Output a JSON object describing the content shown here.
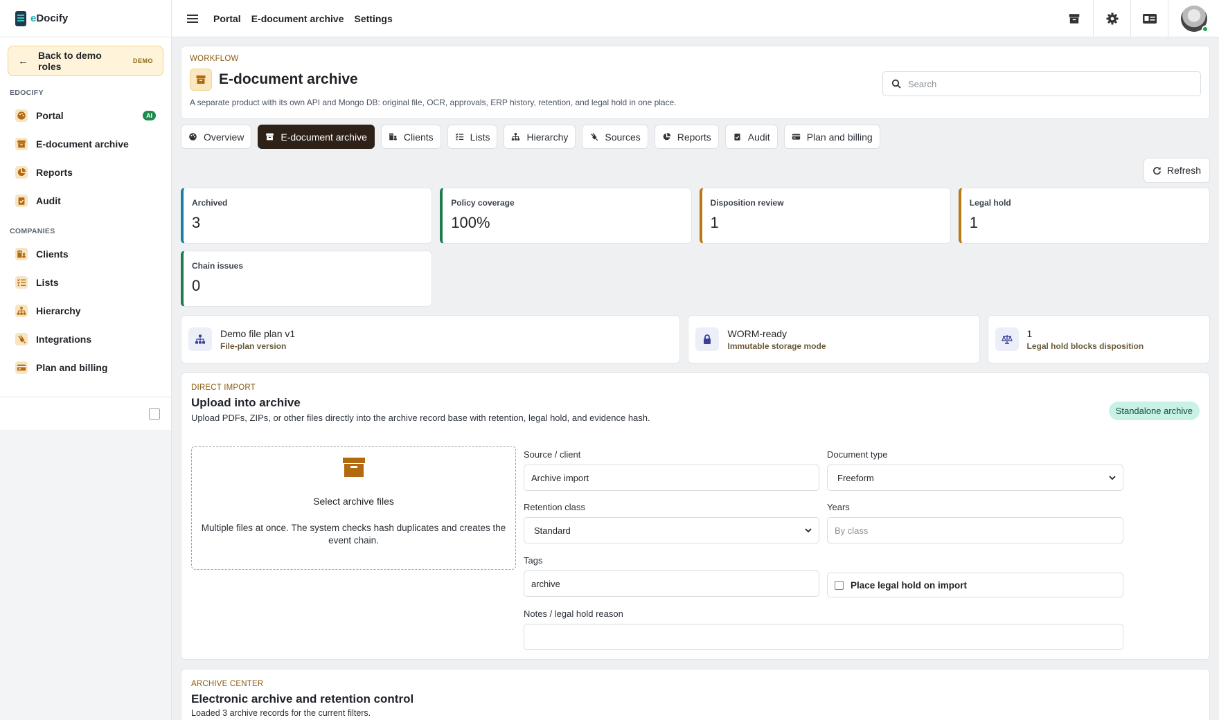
{
  "brand": {
    "prefix": "e",
    "name": "Docify"
  },
  "sidebar": {
    "back_label": "Back to demo roles",
    "back_badge": "DEMO",
    "sections": [
      {
        "title": "EDOCIFY",
        "items": [
          {
            "label": "Portal",
            "icon": "palette-icon",
            "badge": "AI"
          },
          {
            "label": "E-document archive",
            "icon": "archive-box-icon"
          },
          {
            "label": "Reports",
            "icon": "pie-chart-icon"
          },
          {
            "label": "Audit",
            "icon": "clipboard-check-icon"
          }
        ]
      },
      {
        "title": "COMPANIES",
        "items": [
          {
            "label": "Clients",
            "icon": "building-users-icon"
          },
          {
            "label": "Lists",
            "icon": "list-check-icon"
          },
          {
            "label": "Hierarchy",
            "icon": "sitemap-icon"
          },
          {
            "label": "Integrations",
            "icon": "plug-icon"
          },
          {
            "label": "Plan and billing",
            "icon": "credit-card-icon"
          }
        ]
      }
    ]
  },
  "topbar": {
    "links": [
      "Portal",
      "E-document archive",
      "Settings"
    ],
    "icons": [
      "archive-icon",
      "gear-icon",
      "id-card-icon",
      "avatar"
    ]
  },
  "header": {
    "eyebrow": "WORKFLOW",
    "title": "E-document archive",
    "subtitle": "A separate product with its own API and Mongo DB: original file, OCR, approvals, ERP history, retention, and legal hold in one place.",
    "search_placeholder": "Search"
  },
  "tabs": [
    {
      "label": "Overview",
      "icon": "palette-icon"
    },
    {
      "label": "E-document archive",
      "icon": "archive-box-icon",
      "active": true
    },
    {
      "label": "Clients",
      "icon": "building-users-icon"
    },
    {
      "label": "Lists",
      "icon": "list-check-icon"
    },
    {
      "label": "Hierarchy",
      "icon": "sitemap-icon"
    },
    {
      "label": "Sources",
      "icon": "plug-icon"
    },
    {
      "label": "Reports",
      "icon": "pie-chart-icon"
    },
    {
      "label": "Audit",
      "icon": "clipboard-check-icon"
    },
    {
      "label": "Plan and billing",
      "icon": "credit-card-icon"
    }
  ],
  "refresh_label": "Refresh",
  "stats": [
    {
      "label": "Archived",
      "value": "3",
      "accent": "#1a7fa6"
    },
    {
      "label": "Policy coverage",
      "value": "100%",
      "accent": "#1f7a4d"
    },
    {
      "label": "Disposition review",
      "value": "1",
      "accent": "#b97814"
    },
    {
      "label": "Legal hold",
      "value": "1",
      "accent": "#b97814"
    },
    {
      "label": "Chain issues",
      "value": "0",
      "accent": "#1f7a4d"
    }
  ],
  "info_cards": [
    {
      "title": "Demo file plan v1",
      "sub": "File-plan version",
      "icon": "sitemap-icon"
    },
    {
      "title": "WORM-ready",
      "sub": "Immutable storage mode",
      "icon": "lock-icon"
    },
    {
      "title": "1",
      "sub": "Legal hold blocks disposition",
      "icon": "scale-icon"
    }
  ],
  "upload": {
    "eyebrow": "DIRECT IMPORT",
    "title": "Upload into archive",
    "desc": "Upload PDFs, ZIPs, or other files directly into the archive record base with retention, legal hold, and evidence hash.",
    "pill": "Standalone archive",
    "dropzone_title": "Select archive files",
    "dropzone_desc": "Multiple files at once. The system checks hash duplicates and creates the event chain.",
    "source_label": "Source / client",
    "source_value": "Archive import",
    "doctype_label": "Document type",
    "doctype_value": "Freeform",
    "retention_label": "Retention class",
    "retention_value": "Standard",
    "years_label": "Years",
    "years_placeholder": "By class",
    "tags_label": "Tags",
    "tags_value": "archive",
    "legal_hold_label": "Place legal hold on import",
    "notes_label": "Notes / legal hold reason",
    "notes_value": ""
  },
  "archive_center": {
    "eyebrow": "ARCHIVE CENTER",
    "title": "Electronic archive and retention control",
    "desc": "Loaded 3 archive records for the current filters."
  }
}
